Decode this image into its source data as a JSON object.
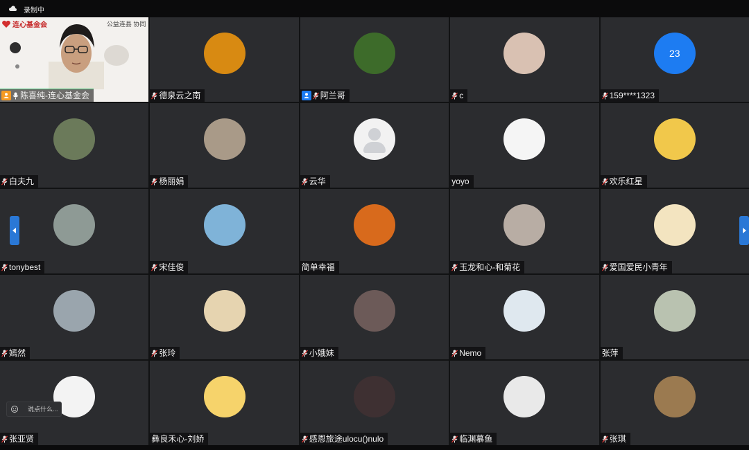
{
  "status_bar": {
    "recording_label": "录制中"
  },
  "presenter": {
    "logo_text": "连心基金会",
    "watermark": "公益连县 协同",
    "name": "陈喜纯-连心基金会"
  },
  "participants": [
    {
      "name": "德泉云之南",
      "avatar": "sunflower",
      "bg": "#d88a12"
    },
    {
      "name": "阿兰哥",
      "avatar": "forest",
      "bg": "#3d6b2a",
      "badge": "host"
    },
    {
      "name": "c",
      "avatar": "portrait-woman",
      "bg": "#d9c1b2"
    },
    {
      "name": "159****1323",
      "avatar": "number",
      "initials": "23",
      "bg": "#1d7cf2"
    },
    {
      "name": "白夫九",
      "avatar": "man-outdoor",
      "bg": "#6b7a5a"
    },
    {
      "name": "杨丽娟",
      "avatar": "street-people",
      "bg": "#a99a88"
    },
    {
      "name": "云华",
      "avatar": "default",
      "bg": "#f2f2f2"
    },
    {
      "name": "yoyo",
      "avatar": "no-face",
      "bg": "#f5f5f5",
      "no_mic": true
    },
    {
      "name": "欢乐红星",
      "avatar": "horse-cartoon",
      "bg": "#f1c84b"
    },
    {
      "name": "tonybest",
      "avatar": "hiker",
      "bg": "#8e9a95"
    },
    {
      "name": "宋佳俊",
      "avatar": "beach-person",
      "bg": "#7fb3d8"
    },
    {
      "name": "简单幸福",
      "avatar": "orange-flowers",
      "bg": "#d86a1c",
      "no_mic": true
    },
    {
      "name": "玉龙和心-和菊花",
      "avatar": "rock-cliff",
      "bg": "#b8ada4"
    },
    {
      "name": "爱国爱民小青年",
      "avatar": "cartoon-mascot",
      "bg": "#f3e4c0"
    },
    {
      "name": "嫣然",
      "avatar": "lake-scene",
      "bg": "#9aa5ad"
    },
    {
      "name": "张玲",
      "avatar": "girl-hat",
      "bg": "#e6d4b0"
    },
    {
      "name": "小娥妹",
      "avatar": "sunset-silhouette",
      "bg": "#6c5a58"
    },
    {
      "name": "Nemo",
      "avatar": "baby",
      "bg": "#dfe8ef"
    },
    {
      "name": "张萍",
      "avatar": "woman-scarf",
      "bg": "#b9c2b0",
      "no_mic": true
    },
    {
      "name": "张亚贤",
      "avatar": "anime-girl",
      "bg": "#f3f3f3"
    },
    {
      "name": "彝良禾心-刘娇",
      "avatar": "cartoon-girl-yellow-hat",
      "bg": "#f6d36b",
      "no_mic": true
    },
    {
      "name": "感恩旅途ulocu()nulo",
      "avatar": "dark-portrait",
      "bg": "#3e3032"
    },
    {
      "name": "临渊慕鱼",
      "avatar": "dog-costume",
      "bg": "#e9e9e9"
    },
    {
      "name": "张琪",
      "avatar": "town-view",
      "bg": "#9b7a50"
    }
  ],
  "chat_input": {
    "placeholder": "说点什么..."
  },
  "colors": {
    "accent": "#1d7cf2",
    "tile_bg": "#2b2c2f",
    "active_speaker": "#36c26f"
  }
}
